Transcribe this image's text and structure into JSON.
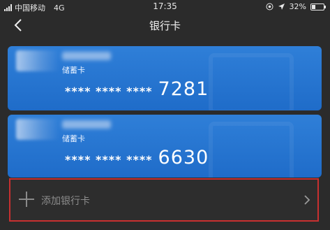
{
  "status_bar": {
    "carrier": "中国移动",
    "network": "4G",
    "time": "17:35",
    "battery": "32%",
    "battery_level": 0.32
  },
  "nav": {
    "title": "银行卡",
    "back_icon": "chevron-left-icon"
  },
  "cards": [
    {
      "type": "储蓄卡",
      "mask": "**** **** ****",
      "last4": "7281"
    },
    {
      "type": "储蓄卡",
      "mask": "**** **** ****",
      "last4": "6630"
    }
  ],
  "add_card": {
    "label": "添加银行卡",
    "icon": "plus-icon",
    "chevron": "chevron-right-icon"
  },
  "colors": {
    "background": "#2b2b2b",
    "card_blue": "#2a78d4",
    "highlight_border": "#c83030"
  }
}
